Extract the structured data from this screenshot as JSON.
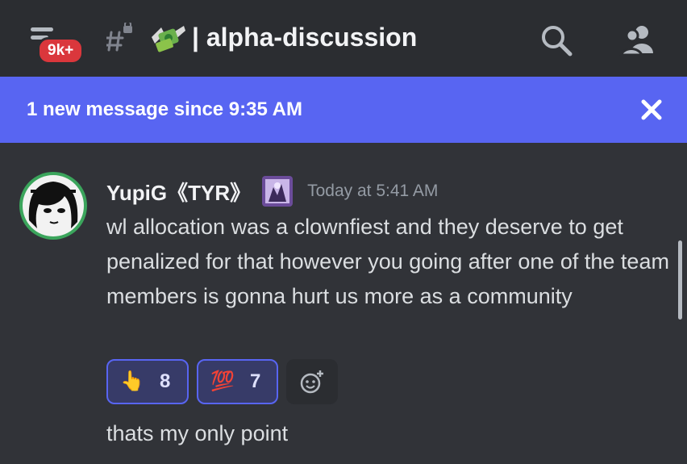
{
  "header": {
    "unread_badge": "9k+",
    "channel_name": "| alpha-discussion",
    "icons": [
      "menu-icon",
      "locked-channel-icon",
      "money-icon",
      "search-icon",
      "members-icon"
    ]
  },
  "banner": {
    "text": "1 new message since 9:35 AM",
    "close_icon": "close-icon"
  },
  "message": {
    "author": "YupiG《TYR》",
    "timestamp": "Today at 5:41 AM",
    "body": "wl allocation was a clownfiest and they deserve to get penalized for that however you going after one of the team members is gonna hurt us more as a community",
    "followup": "thats my only point",
    "reactions": [
      {
        "emoji": "👆",
        "icon": "pointing-up-hand-icon",
        "count": "8"
      },
      {
        "emoji": "💯",
        "icon": "hundred-points-icon",
        "count": "7"
      }
    ],
    "add_reaction_icon": "add-reaction-icon"
  },
  "colors": {
    "background": "#313338",
    "header": "#2b2d31",
    "banner": "#5865f2",
    "badge": "#da373c",
    "avatar_ring": "#3ba55c"
  }
}
